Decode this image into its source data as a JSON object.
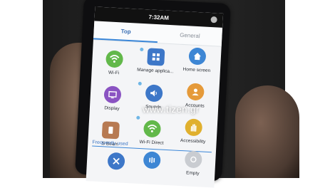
{
  "status": {
    "time": "7:32AM"
  },
  "tabs": [
    {
      "label": "Top",
      "active": true
    },
    {
      "label": "General",
      "active": false
    }
  ],
  "items": [
    {
      "label": "Wi-Fi",
      "icon": "wifi-icon",
      "color": "#62b84a"
    },
    {
      "label": "Manage applica...",
      "icon": "apps-grid-icon",
      "color": "#3d77c8"
    },
    {
      "label": "Home screen",
      "icon": "home-icon",
      "color": "#3d86d4"
    },
    {
      "label": "Display",
      "icon": "display-icon",
      "color": "#8a53c2"
    },
    {
      "label": "Sounds",
      "icon": "speaker-icon",
      "color": "#3d77c8"
    },
    {
      "label": "Accounts",
      "icon": "accounts-icon",
      "color": "#e59a3a"
    },
    {
      "label": "S Beam",
      "icon": "s-beam-icon",
      "color": "#b77a52"
    },
    {
      "label": "Wi-Fi Direct",
      "icon": "wifi-direct-icon",
      "color": "#62b84a"
    },
    {
      "label": "Accessibility",
      "icon": "hand-icon",
      "color": "#e0b02e"
    }
  ],
  "section": {
    "label": "Frequently used"
  },
  "frequent": [
    {
      "label": "",
      "icon": "tools-icon",
      "color": "#3d77c8"
    },
    {
      "label": "",
      "icon": "vibration-icon",
      "color": "#3d86d4"
    },
    {
      "label": "Empty",
      "icon": "empty-icon",
      "color": "#c9ccd1"
    }
  ],
  "watermark": "www.tizen.gr"
}
